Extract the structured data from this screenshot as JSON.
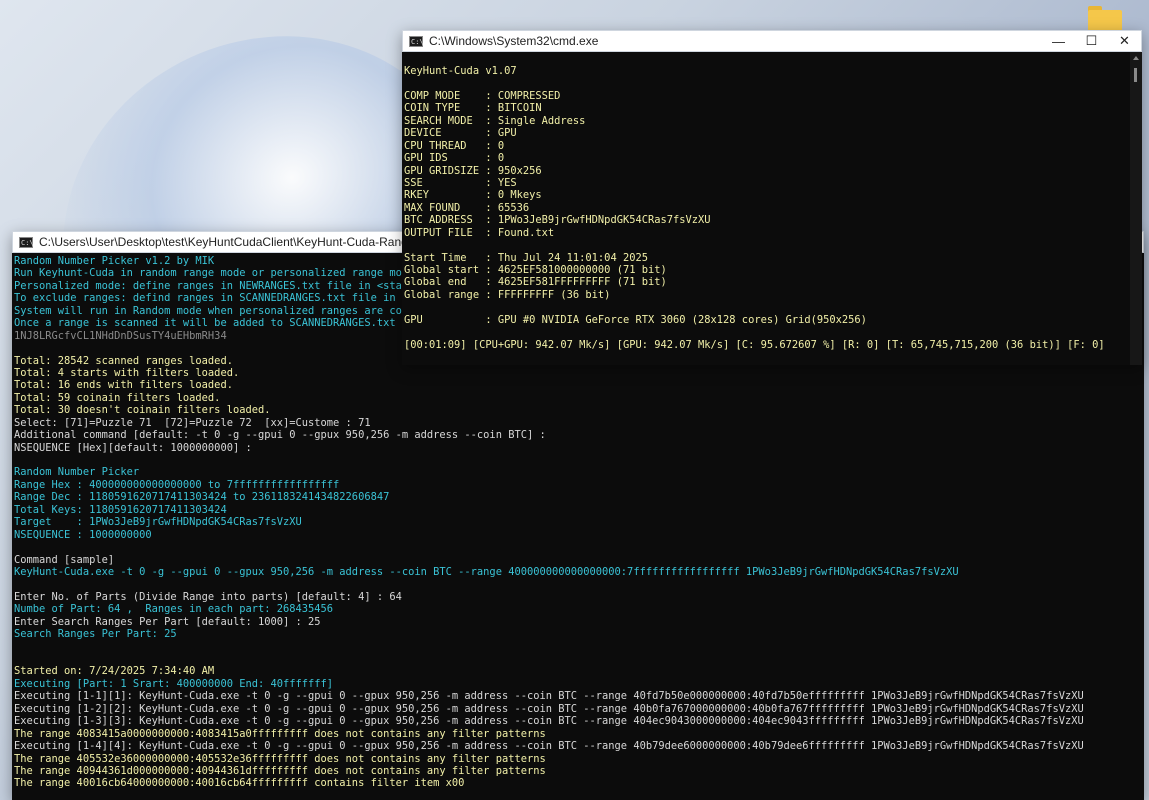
{
  "right_window": {
    "title": "C:\\Windows\\System32\\cmd.exe",
    "lines": [
      {
        "t": "KeyHunt-Cuda v1.07",
        "c": "c-yellow"
      },
      {
        "t": "",
        "c": "c-yellow"
      },
      {
        "t": "COMP MODE    : COMPRESSED",
        "c": "c-yellow"
      },
      {
        "t": "COIN TYPE    : BITCOIN",
        "c": "c-yellow"
      },
      {
        "t": "SEARCH MODE  : Single Address",
        "c": "c-yellow"
      },
      {
        "t": "DEVICE       : GPU",
        "c": "c-yellow"
      },
      {
        "t": "CPU THREAD   : 0",
        "c": "c-yellow"
      },
      {
        "t": "GPU IDS      : 0",
        "c": "c-yellow"
      },
      {
        "t": "GPU GRIDSIZE : 950x256",
        "c": "c-yellow"
      },
      {
        "t": "SSE          : YES",
        "c": "c-yellow"
      },
      {
        "t": "RKEY         : 0 Mkeys",
        "c": "c-yellow"
      },
      {
        "t": "MAX FOUND    : 65536",
        "c": "c-yellow"
      },
      {
        "t": "BTC ADDRESS  : 1PWo3JeB9jrGwfHDNpdGK54CRas7fsVzXU",
        "c": "c-yellow"
      },
      {
        "t": "OUTPUT FILE  : Found.txt",
        "c": "c-yellow"
      },
      {
        "t": "",
        "c": "c-yellow"
      },
      {
        "t": "Start Time   : Thu Jul 24 11:01:04 2025",
        "c": "c-yellow"
      },
      {
        "t": "Global start : 4625EF581000000000 (71 bit)",
        "c": "c-yellow"
      },
      {
        "t": "Global end   : 4625EF581FFFFFFFFF (71 bit)",
        "c": "c-yellow"
      },
      {
        "t": "Global range : FFFFFFFFF (36 bit)",
        "c": "c-yellow"
      },
      {
        "t": "",
        "c": "c-yellow"
      },
      {
        "t": "GPU          : GPU #0 NVIDIA GeForce RTX 3060 (28x128 cores) Grid(950x256)",
        "c": "c-yellow"
      },
      {
        "t": "",
        "c": "c-yellow"
      },
      {
        "t": "[00:01:09] [CPU+GPU: 942.07 Mk/s] [GPU: 942.07 Mk/s] [C: 95.672607 %] [R: 0] [T: 65,745,715,200 (36 bit)] [F: 0]",
        "c": "c-yellow"
      }
    ]
  },
  "left_window": {
    "title": "C:\\Users\\User\\Desktop\\test\\KeyHuntCudaClient\\KeyHunt-Cuda-RandomNumberPicker v",
    "lines": [
      {
        "t": "Random Number Picker v1.2 by MIK",
        "c": "c-cyan"
      },
      {
        "t": "Run Keyhunt-Cuda in random range mode or personalized range mod",
        "c": "c-cyan"
      },
      {
        "t": "Personalized mode: define ranges in NEWRANGES.txt file in <star",
        "c": "c-cyan"
      },
      {
        "t": "To exclude ranges: defind ranges in SCANNEDRANGES.txt file in <",
        "c": "c-cyan"
      },
      {
        "t": "System will run in Random mode when personalized ranges are com",
        "c": "c-cyan"
      },
      {
        "t": "Once a range is scanned it will be added to SCANNEDRANGES.txt t",
        "c": "c-cyan"
      },
      {
        "t": "1NJ8LRGcfvCL1NHdDnDSusTY4uEHbmRH34",
        "c": "c-gray"
      },
      {
        "t": "",
        "c": "c-white"
      },
      {
        "t": "Total: 28542 scanned ranges loaded.",
        "c": "c-yellow"
      },
      {
        "t": "Total: 4 starts with filters loaded.",
        "c": "c-yellow"
      },
      {
        "t": "Total: 16 ends with filters loaded.",
        "c": "c-yellow"
      },
      {
        "t": "Total: 59 coinain filters loaded.",
        "c": "c-yellow"
      },
      {
        "t": "Total: 30 doesn't coinain filters loaded.",
        "c": "c-yellow"
      },
      {
        "t": "Select: [71]=Puzzle 71  [72]=Puzzle 72  [xx]=Custome : 71",
        "c": "c-white"
      },
      {
        "t": "Additional command [default: -t 0 -g --gpui 0 --gpux 950,256 -m address --coin BTC] :",
        "c": "c-white"
      },
      {
        "t": "NSEQUENCE [Hex][default: 1000000000] :",
        "c": "c-white"
      },
      {
        "t": "",
        "c": "c-white"
      },
      {
        "t": "Random Number Picker",
        "c": "c-cyan"
      },
      {
        "t": "Range Hex : 400000000000000000 to 7fffffffffffffffff",
        "c": "c-cyan"
      },
      {
        "t": "Range Dec : 1180591620717411303424 to 2361183241434822606847",
        "c": "c-cyan"
      },
      {
        "t": "Total Keys: 1180591620717411303424",
        "c": "c-cyan"
      },
      {
        "t": "Target    : 1PWo3JeB9jrGwfHDNpdGK54CRas7fsVzXU",
        "c": "c-cyan"
      },
      {
        "t": "NSEQUENCE : 1000000000",
        "c": "c-cyan"
      },
      {
        "t": "",
        "c": "c-white"
      },
      {
        "t": "Command [sample]",
        "c": "c-white"
      },
      {
        "t": "KeyHunt-Cuda.exe -t 0 -g --gpui 0 --gpux 950,256 -m address --coin BTC --range 400000000000000000:7fffffffffffffffff 1PWo3JeB9jrGwfHDNpdGK54CRas7fsVzXU",
        "c": "c-cyan"
      },
      {
        "t": "",
        "c": "c-white"
      },
      {
        "t": "Enter No. of Parts (Divide Range into parts) [default: 4] : 64",
        "c": "c-white"
      },
      {
        "t": "Numbe of Part: 64 ,  Ranges in each part: 268435456",
        "c": "c-cyan"
      },
      {
        "t": "Enter Search Ranges Per Part [default: 1000] : 25",
        "c": "c-white"
      },
      {
        "t": "Search Ranges Per Part: 25",
        "c": "c-cyan"
      },
      {
        "t": "",
        "c": "c-white"
      },
      {
        "t": "",
        "c": "c-white"
      },
      {
        "t": "Started on: 7/24/2025 7:34:40 AM",
        "c": "c-yellow"
      },
      {
        "t": "Executing [Part: 1 Srart: 400000000 End: 40fffffff]",
        "c": "c-cyan"
      },
      {
        "t": "Executing [1-1][1]: KeyHunt-Cuda.exe -t 0 -g --gpui 0 --gpux 950,256 -m address --coin BTC --range 40fd7b50e000000000:40fd7b50efffffffff 1PWo3JeB9jrGwfHDNpdGK54CRas7fsVzXU",
        "c": "c-white"
      },
      {
        "t": "Executing [1-2][2]: KeyHunt-Cuda.exe -t 0 -g --gpui 0 --gpux 950,256 -m address --coin BTC --range 40b0fa767000000000:40b0fa767fffffffff 1PWo3JeB9jrGwfHDNpdGK54CRas7fsVzXU",
        "c": "c-white"
      },
      {
        "t": "Executing [1-3][3]: KeyHunt-Cuda.exe -t 0 -g --gpui 0 --gpux 950,256 -m address --coin BTC --range 404ec9043000000000:404ec9043fffffffff 1PWo3JeB9jrGwfHDNpdGK54CRas7fsVzXU",
        "c": "c-white"
      },
      {
        "t": "The range 4083415a0000000000:4083415a0fffffffff does not contains any filter patterns",
        "c": "c-yellow"
      },
      {
        "t": "Executing [1-4][4]: KeyHunt-Cuda.exe -t 0 -g --gpui 0 --gpux 950,256 -m address --coin BTC --range 40b79dee6000000000:40b79dee6fffffffff 1PWo3JeB9jrGwfHDNpdGK54CRas7fsVzXU",
        "c": "c-white"
      },
      {
        "t": "The range 405532e36000000000:405532e36fffffffff does not contains any filter patterns",
        "c": "c-yellow"
      },
      {
        "t": "The range 40944361d000000000:40944361dfffffffff does not contains any filter patterns",
        "c": "c-yellow"
      },
      {
        "t": "The range 40016cb64000000000:40016cb64fffffffff contains filter item x00",
        "c": "c-yellow"
      }
    ]
  },
  "controls": {
    "minimize": "—",
    "maximize": "☐",
    "close": "✕"
  }
}
